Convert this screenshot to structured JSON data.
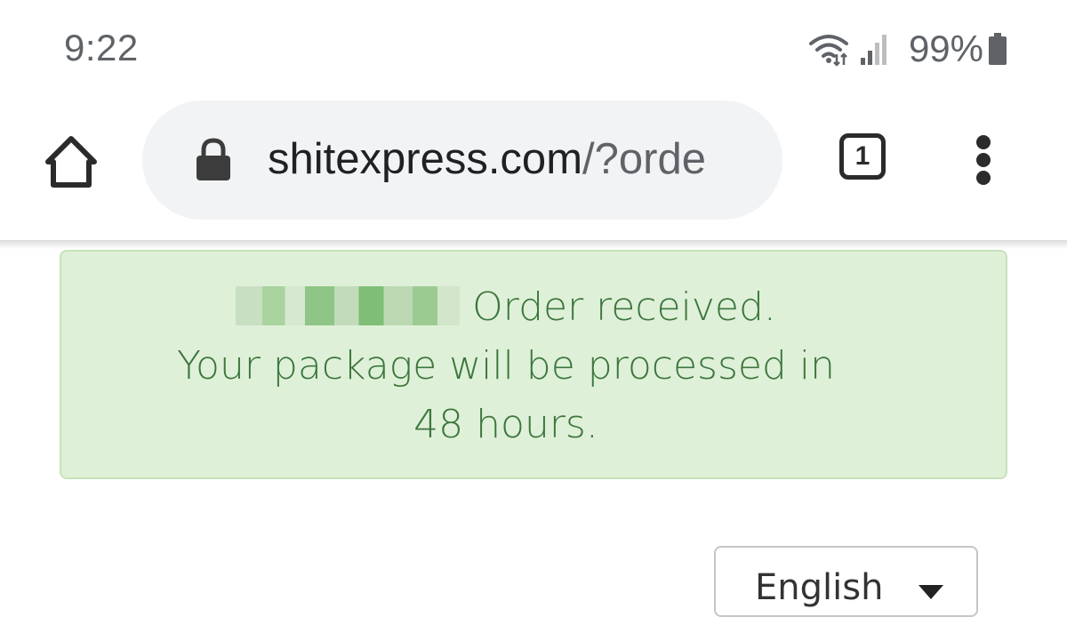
{
  "status_bar": {
    "time": "9:22",
    "battery": "99%",
    "icons": [
      "wifi-icon",
      "signal-icon",
      "battery-icon"
    ]
  },
  "toolbar": {
    "url_host": "shitexpress.com",
    "url_path": "/?orde",
    "tab_count": "1",
    "icons": [
      "home-icon",
      "lock-icon",
      "tab-switcher-icon",
      "more-vert-icon"
    ]
  },
  "alert": {
    "line1": "Order received.",
    "line2": "Your package will be processed in 48 hours.",
    "colors": {
      "background": "#dff0d8",
      "text": "#3c763d",
      "border": "#c7e3bc"
    }
  },
  "language_select": {
    "selected": "English"
  }
}
